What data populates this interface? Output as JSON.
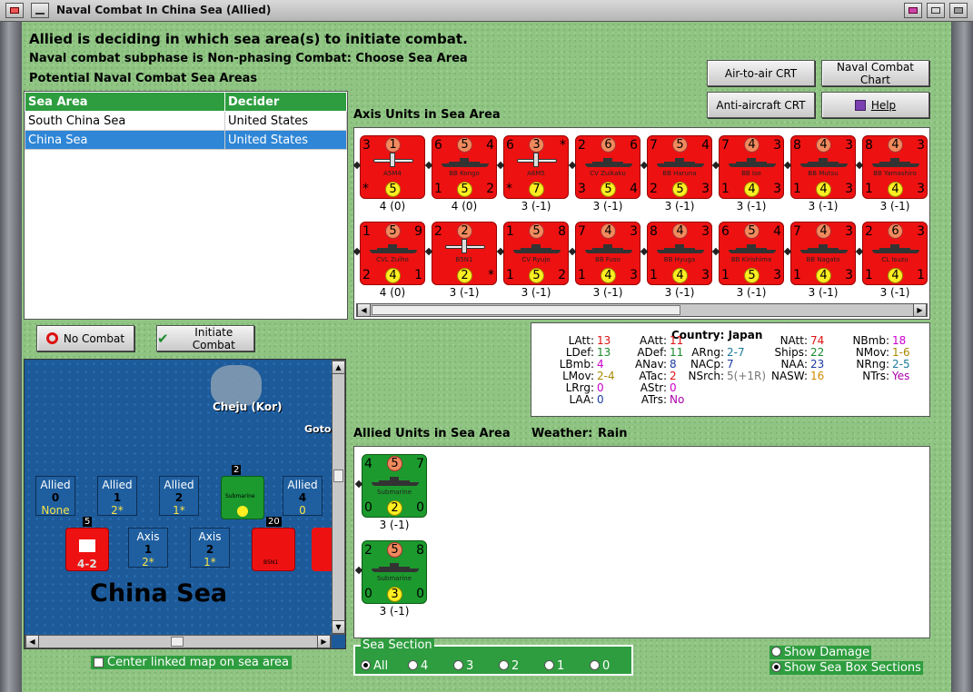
{
  "window": {
    "title": "Naval Combat In China Sea (Allied)"
  },
  "header": {
    "line1": "Allied is deciding in which sea area(s) to initiate combat.",
    "line2": "Naval combat subphase is Non-phasing Combat: Choose Sea Area",
    "line3": "Potential Naval Combat Sea Areas"
  },
  "buttons": {
    "air_crt": "Air-to-air CRT",
    "naval_chart": "Naval Combat Chart",
    "aa_crt": "Anti-aircraft CRT",
    "help": "Help",
    "no_combat": "No Combat",
    "initiate": "Initiate Combat"
  },
  "sea_table": {
    "headers": [
      "Sea Area",
      "Decider"
    ],
    "rows": [
      [
        "South China Sea",
        "United States"
      ],
      [
        "China Sea",
        "United States"
      ]
    ]
  },
  "axis_title": "Axis Units in Sea Area",
  "axis_units": [
    {
      "tl": "3",
      "tc": "1",
      "tr": "",
      "bl": "*",
      "bc": "5",
      "br": "",
      "name": "A5M4",
      "kind": "plane",
      "label": "4 (0)"
    },
    {
      "tl": "6",
      "tc": "5",
      "tr": "4",
      "bl": "1",
      "bc": "5",
      "br": "2",
      "name": "BB Kongo",
      "kind": "ship",
      "label": "4 (0)"
    },
    {
      "tl": "6",
      "tc": "3",
      "tr": "*",
      "bl": "*",
      "bc": "7",
      "br": "",
      "name": "A6M5",
      "kind": "plane",
      "label": "3 (-1)"
    },
    {
      "tl": "2",
      "tc": "6",
      "tr": "6",
      "bl": "3",
      "bc": "5",
      "br": "4",
      "name": "CV Zuikaku",
      "kind": "ship",
      "label": "3 (-1)"
    },
    {
      "tl": "7",
      "tc": "5",
      "tr": "4",
      "bl": "2",
      "bc": "5",
      "br": "3",
      "name": "BB Haruna",
      "kind": "ship",
      "label": "3 (-1)"
    },
    {
      "tl": "7",
      "tc": "4",
      "tr": "3",
      "bl": "1",
      "bc": "4",
      "br": "3",
      "name": "BB Ise",
      "kind": "ship",
      "label": "3 (-1)"
    },
    {
      "tl": "8",
      "tc": "4",
      "tr": "3",
      "bl": "1",
      "bc": "4",
      "br": "3",
      "name": "BB Mutsu",
      "kind": "ship",
      "label": "3 (-1)"
    },
    {
      "tl": "8",
      "tc": "4",
      "tr": "3",
      "bl": "1",
      "bc": "4",
      "br": "3",
      "name": "BB Yamashiro",
      "kind": "ship",
      "label": "3 (-1)"
    },
    {
      "tl": "1",
      "tc": "5",
      "tr": "9",
      "bl": "2",
      "bc": "4",
      "br": "1",
      "name": "CVL Zuiho",
      "kind": "ship",
      "label": "4 (0)"
    },
    {
      "tl": "2",
      "tc": "2",
      "tr": "",
      "bl": "",
      "bc": "2",
      "br": "*",
      "name": "B5N1",
      "kind": "plane",
      "label": "3 (-1)"
    },
    {
      "tl": "1",
      "tc": "5",
      "tr": "8",
      "bl": "1",
      "bc": "5",
      "br": "2",
      "name": "CV Ryujo",
      "kind": "ship",
      "label": "3 (-1)"
    },
    {
      "tl": "7",
      "tc": "4",
      "tr": "3",
      "bl": "1",
      "bc": "4",
      "br": "3",
      "name": "BB Fuso",
      "kind": "ship",
      "label": "3 (-1)"
    },
    {
      "tl": "8",
      "tc": "4",
      "tr": "3",
      "bl": "1",
      "bc": "4",
      "br": "3",
      "name": "BB Hyuga",
      "kind": "ship",
      "label": "3 (-1)"
    },
    {
      "tl": "6",
      "tc": "5",
      "tr": "4",
      "bl": "1",
      "bc": "5",
      "br": "3",
      "name": "BB Kirishima",
      "kind": "ship",
      "label": "3 (-1)"
    },
    {
      "tl": "7",
      "tc": "4",
      "tr": "3",
      "bl": "1",
      "bc": "4",
      "br": "3",
      "name": "BB Nagato",
      "kind": "ship",
      "label": "3 (-1)"
    },
    {
      "tl": "2",
      "tc": "6",
      "tr": "3",
      "bl": "1",
      "bc": "4",
      "br": "1",
      "name": "CL Isuzu",
      "kind": "ship",
      "label": "3 (-1)"
    }
  ],
  "stats": {
    "country_label": "Country:",
    "country": "Japan",
    "items": [
      {
        "k": "LAtt:",
        "v": "13",
        "c": "#d11"
      },
      {
        "k": "LDef:",
        "v": "13",
        "c": "#1a8a2a"
      },
      {
        "k": "LBmb:",
        "v": "4",
        "c": "#c0c"
      },
      {
        "k": "LMov:",
        "v": "2-4",
        "c": "#a88a00"
      },
      {
        "k": "LRrg:",
        "v": "0",
        "c": "#c0c"
      },
      {
        "k": "LAA:",
        "v": "0",
        "c": "#1a3aa0"
      },
      {
        "k": "AAtt:",
        "v": "11",
        "c": "#d11"
      },
      {
        "k": "ADef:",
        "v": "11",
        "c": "#1a8a2a"
      },
      {
        "k": "ANav:",
        "v": "8",
        "c": "#1a3aa0"
      },
      {
        "k": "ATac:",
        "v": "2",
        "c": "#d11"
      },
      {
        "k": "AStr:",
        "v": "0",
        "c": "#c0c"
      },
      {
        "k": "ATrs:",
        "v": "No",
        "c": "#a0a"
      },
      {
        "k": "ARng:",
        "v": "2-7",
        "c": "#1a7a9a"
      },
      {
        "k": "NACp:",
        "v": "7",
        "c": "#1a3aa0"
      },
      {
        "k": "NSrch:",
        "v": "5(+1R)",
        "c": "#777"
      },
      {
        "k": "NAtt:",
        "v": "74",
        "c": "#d11"
      },
      {
        "k": "Ships:",
        "v": "22",
        "c": "#1a8a2a"
      },
      {
        "k": "NAA:",
        "v": "23",
        "c": "#1a3aa0"
      },
      {
        "k": "NASW:",
        "v": "16",
        "c": "#d08a00"
      },
      {
        "k": "NBmb:",
        "v": "18",
        "c": "#c0c"
      },
      {
        "k": "NMov:",
        "v": "1-6",
        "c": "#a88a00"
      },
      {
        "k": "NRng:",
        "v": "2-5",
        "c": "#1a7a9a"
      },
      {
        "k": "NTrs:",
        "v": "Yes",
        "c": "#a0a"
      }
    ]
  },
  "allied_title": "Allied Units in Sea Area",
  "weather_label": "Weather:",
  "weather": "Rain",
  "allied_units": [
    {
      "tl": "4",
      "tc": "5",
      "tr": "7",
      "bl": "0",
      "bc": "2",
      "br": "0",
      "name": "Submarine",
      "label": "3 (-1)"
    },
    {
      "tl": "2",
      "tc": "5",
      "tr": "8",
      "bl": "0",
      "bc": "3",
      "br": "0",
      "name": "Submarine",
      "label": "3 (-1)"
    }
  ],
  "map": {
    "island": "Cheju (Kor)",
    "goto": "Goto",
    "sea_name": "China Sea",
    "allied_boxes": [
      {
        "t": "Allied",
        "n": "0",
        "s": "None"
      },
      {
        "t": "Allied",
        "n": "1",
        "s": "2*"
      },
      {
        "t": "Allied",
        "n": "2",
        "s": "1*"
      },
      {
        "t": "Allied",
        "n": "4",
        "s": "0"
      }
    ],
    "axis_boxes": [
      {
        "t": "Axis",
        "n": "1",
        "s": "2*"
      },
      {
        "t": "Axis",
        "n": "2",
        "s": "1*"
      }
    ],
    "stack_counts": [
      "2",
      "5",
      "20"
    ],
    "map_units": {
      "sub": "Submarine",
      "axis_left": "4-2",
      "axis_plane": "B5N1"
    }
  },
  "center_map": "Center linked map on sea area",
  "sea_section": {
    "title": "Sea Section",
    "options": [
      "All",
      "4",
      "3",
      "2",
      "1",
      "0"
    ]
  },
  "options": {
    "show_damage": "Show Damage",
    "show_boxes": "Show Sea Box Sections"
  },
  "colors": {
    "axis": "#ee1111",
    "allied": "#1c9a2e",
    "selection": "#2f86d6",
    "header": "#2e9d3f",
    "sea": "#1f5fa0"
  }
}
